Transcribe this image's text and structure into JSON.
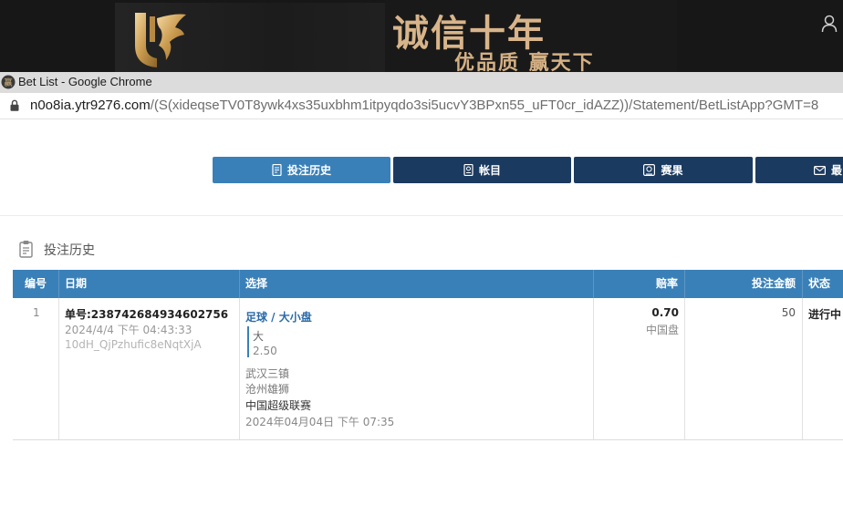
{
  "banner": {
    "slogan_main": "诚信十年",
    "slogan_sub": "优品质 赢天下",
    "colors": {
      "background": "#171717",
      "gold": "#d8b48a"
    }
  },
  "window": {
    "title": "Bet List - Google Chrome",
    "url_host": "n0o8ia.ytr9276.com",
    "url_path": "/(S(xideqseTV0T8ywk4xs35uxbhm1itpyqdo3si5ucvY3BPxn55_uFT0cr_idAZZ))/Statement/BetListApp?GMT=8"
  },
  "nav": {
    "items": [
      {
        "label": "投注历史",
        "icon": "receipt-icon",
        "active": true
      },
      {
        "label": "帐目",
        "icon": "ledger-icon",
        "active": false
      },
      {
        "label": "赛果",
        "icon": "results-icon",
        "active": false
      },
      {
        "label": "最",
        "icon": "mail-icon",
        "active": false
      }
    ],
    "colors": {
      "active": "#3a80b8",
      "inactive": "#1b3a60"
    }
  },
  "section": {
    "title": "投注历史",
    "icon": "clipboard-icon"
  },
  "table": {
    "headers": {
      "no": "编号",
      "date": "日期",
      "selection": "选择",
      "odds": "赔率",
      "amount": "投注金额",
      "status": "状态"
    },
    "rows": [
      {
        "no": "1",
        "ticket": "单号:238742684934602756",
        "datetime": "2024/4/4 下午 04:43:33",
        "ref": "10dH_QjPzhufic8eNqtXjA",
        "sport_market": "足球 / 大小盘",
        "pick": "大",
        "handicap": "2.50",
        "home": "武汉三镇",
        "away": "沧州雄狮",
        "league": "中国超级联赛",
        "kickoff": "2024年04月04日 下午 07:35",
        "odds": "0.70",
        "odds_type": "中国盘",
        "amount": "50",
        "status": "进行中"
      }
    ]
  }
}
